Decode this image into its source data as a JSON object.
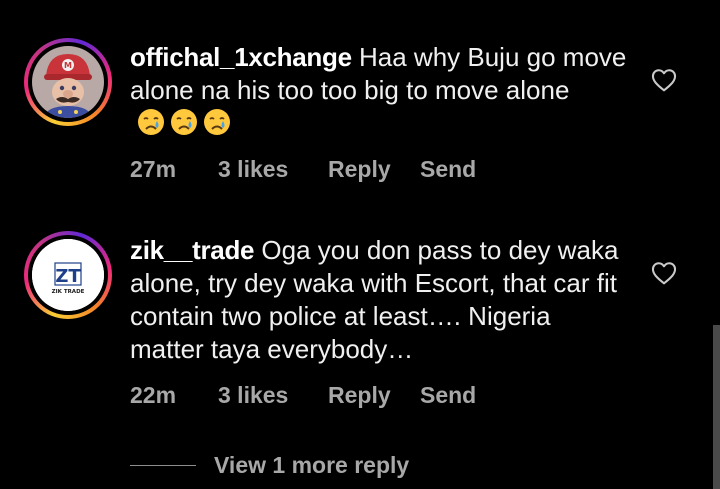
{
  "comments": [
    {
      "username": "offichal_1xchange",
      "text": "Haa why Buju go move alone na his too too big to move alone",
      "emoji_count": 3,
      "emoji_name": "crying-face",
      "time": "27m",
      "likes": "3 likes",
      "reply_label": "Reply",
      "send_label": "Send",
      "avatar": "mario-cap-avatar"
    },
    {
      "username": "zik__trade",
      "text": "Oga you don pass to dey waka alone, try dey waka with Escort, that car fit contain two police at least…. Nigeria matter taya everybody…",
      "time": "22m",
      "likes": "3 likes",
      "reply_label": "Reply",
      "send_label": "Send",
      "avatar_logo": "ZT",
      "avatar_caption": "ZIK TRADE"
    }
  ],
  "view_more_label": "View 1 more reply",
  "colors": {
    "background": "#000000",
    "primary_text": "#f0f0f0",
    "secondary_text": "#a8a8a8",
    "story_ring": [
      "#f9ce34",
      "#ee2a7b",
      "#6228d7"
    ]
  },
  "icons": {
    "like": "heart-outline-icon"
  }
}
